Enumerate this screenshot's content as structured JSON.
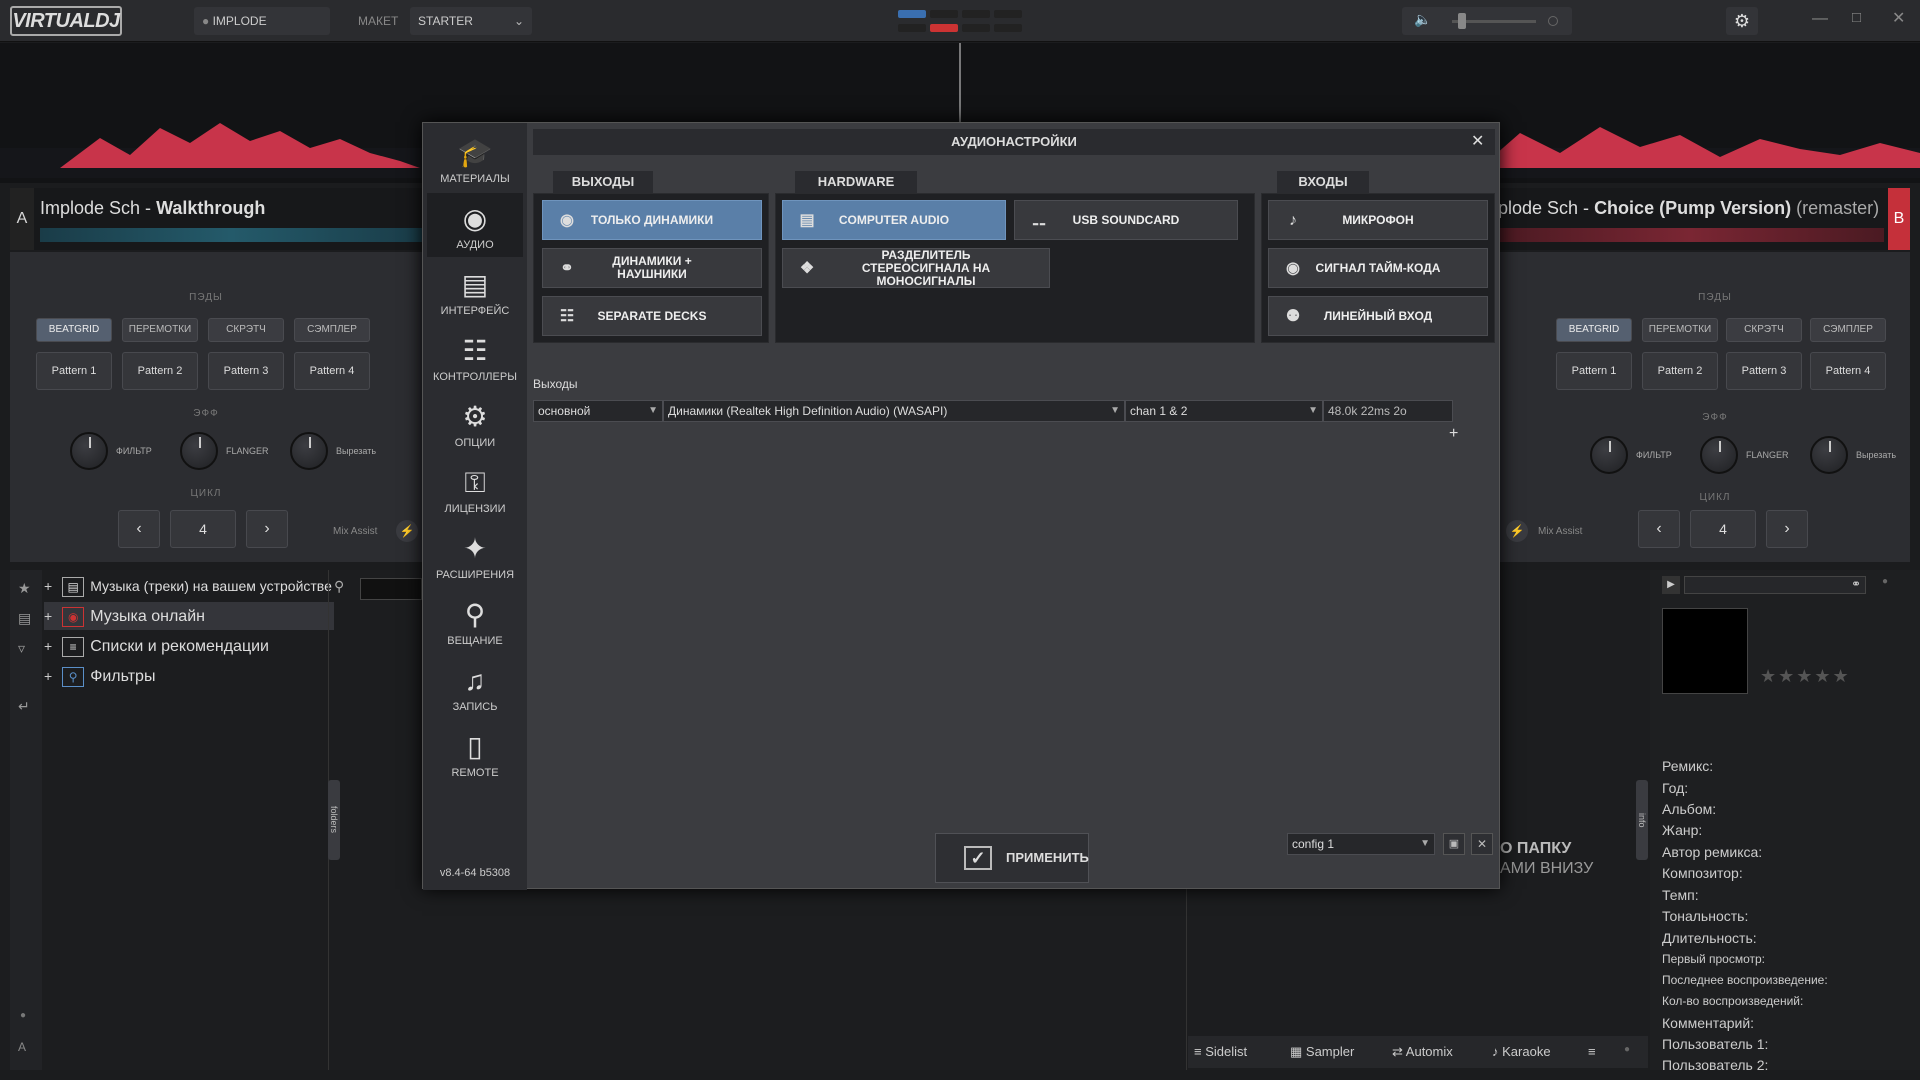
{
  "app": {
    "logo": "VIRTUALDJ",
    "skin_user": "IMPLODE",
    "layout_label": "МАКЕТ",
    "layout_value": "STARTER"
  },
  "decks": {
    "a": {
      "letter": "A",
      "artist": "Implode Sch - ",
      "title": "Walkthrough",
      "pads_label": "ПЭДЫ",
      "pad_modes": [
        "BEATGRID",
        "ПЕРЕМОТКИ",
        "СКРЭТЧ",
        "СЭМПЛЕР"
      ],
      "patterns": [
        "Pattern 1",
        "Pattern 2",
        "Pattern 3",
        "Pattern 4"
      ],
      "eff_label": "ЭФФ",
      "knobs": [
        "ФИЛЬТР",
        "FLANGER",
        "Вырезать"
      ],
      "loop_label": "ЦИКЛ",
      "loop_value": "4",
      "mix_assist": "Mix Assist"
    },
    "b": {
      "letter": "B",
      "artist": "plode Sch - ",
      "title": "Choice (Pump Version)",
      "remaster": " (remaster)",
      "pads_label": "ПЭДЫ",
      "pad_modes": [
        "BEATGRID",
        "ПЕРЕМОТКИ",
        "СКРЭТЧ",
        "СЭМПЛЕР"
      ],
      "patterns": [
        "Pattern 1",
        "Pattern 2",
        "Pattern 3",
        "Pattern 4"
      ],
      "eff_label": "ЭФФ",
      "knobs": [
        "ФИЛЬТР",
        "FLANGER",
        "Вырезать"
      ],
      "loop_label": "ЦИКЛ",
      "loop_value": "4",
      "mix_assist": "Mix Assist"
    }
  },
  "dialog": {
    "title": "АУДИОНАСТРОЙКИ",
    "sidebar": [
      {
        "label": "МАТЕРИАЛЫ",
        "icon": "graduation-cap-icon"
      },
      {
        "label": "АУДИО",
        "icon": "speaker-icon"
      },
      {
        "label": "ИНТЕРФЕЙС",
        "icon": "monitor-icon"
      },
      {
        "label": "КОНТРОЛЛЕРЫ",
        "icon": "mixer-icon"
      },
      {
        "label": "ОПЦИИ",
        "icon": "gear-icon"
      },
      {
        "label": "ЛИЦЕНЗИИ",
        "icon": "lock-icon"
      },
      {
        "label": "РАСШИРЕНИЯ",
        "icon": "puzzle-icon"
      },
      {
        "label": "ВЕЩАНИЕ",
        "icon": "broadcast-icon"
      },
      {
        "label": "ЗАПИСЬ",
        "icon": "record-icon"
      },
      {
        "label": "REMOTE",
        "icon": "phone-icon"
      }
    ],
    "version": "v8.4-64 b5308",
    "outputs_tab": "ВЫХОДЫ",
    "outputs": [
      "ТОЛЬКО ДИНАМИКИ",
      "ДИНАМИКИ + НАУШНИКИ",
      "SEPARATE DECKS"
    ],
    "hardware_tab": "HARDWARE",
    "hardware": [
      "COMPUTER AUDIO",
      "USB SOUNDCARD",
      "РАЗДЕЛИТЕЛЬ СТЕРЕОСИГНАЛА НА МОНОСИГНАЛЫ"
    ],
    "inputs_tab": "ВХОДЫ",
    "inputs": [
      "МИКРОФОН",
      "СИГНАЛ ТАЙМ-КОДА",
      "ЛИНЕЙНЫЙ ВХОД"
    ],
    "outputs_label": "Выходы",
    "row": {
      "type": "основной",
      "device": "Динамики (Realtek High Definition Audio) (WASAPI)",
      "channels": "chan 1 & 2",
      "info": "48.0k 22ms 2o"
    },
    "config": "config 1",
    "apply": "ПРИМЕНИТЬ"
  },
  "browser": {
    "tree": [
      "Музыка (треки) на вашем устройстве",
      "Музыка онлайн",
      "Списки и рекомендации",
      "Фильтры"
    ],
    "folders_tab": "folders",
    "info_tab": "info",
    "empty_hint_1": "О ПАПКУ",
    "empty_hint_2": "АМИ ВНИЗУ",
    "info_fields": [
      "Ремикс:",
      "Год:",
      "Альбом:",
      "Жанр:",
      "Автор ремикса:",
      "Композитор:",
      "Темп:",
      "Тональность:",
      "Длительность:"
    ],
    "info_fields_small": [
      "Первый просмотр:",
      "Последнее воспроизведение:",
      "Кол-во воспроизведений:"
    ],
    "info_fields2": [
      "Комментарий:",
      "Пользователь 1:",
      "Пользователь 2:"
    ],
    "bottom": [
      "Sidelist",
      "Sampler",
      "Automix",
      "Karaoke"
    ]
  }
}
